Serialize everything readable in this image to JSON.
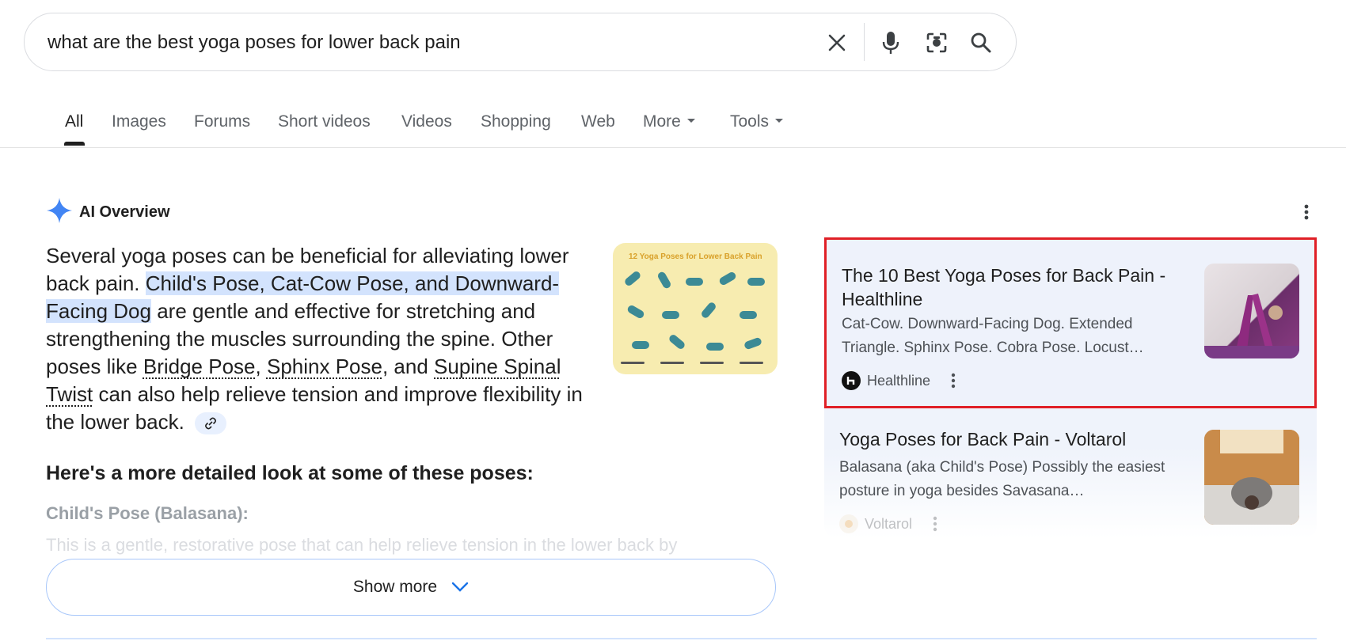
{
  "search": {
    "query": "what are the best yoga poses for lower back pain"
  },
  "tabs": [
    "All",
    "Images",
    "Forums",
    "Short videos",
    "Videos",
    "Shopping",
    "Web",
    "More",
    "Tools"
  ],
  "ai_overview": {
    "title": "AI Overview",
    "body": {
      "p1": "Several yoga poses can be beneficial for alleviating lower back pain.",
      "highlight": "Child's Pose, Cat-Cow Pose, and Downward-Facing Dog",
      "p2": "are gentle and effective for stretching and strengthening the muscles surrounding the spine. Other poses like",
      "link1": "Bridge Pose",
      "link2": "Sphinx Pose",
      "sep": ", and",
      "link3": "Supine Spinal Twist",
      "p3": "can also help relieve tension and improve flexibility in the lower back."
    },
    "image_caption": "12 Yoga Poses for Lower Back Pain",
    "detail_heading": "Here's a more detailed look at some of these poses:",
    "sub_heading": "Child's Pose (Balasana):",
    "faded_text": "This is a gentle, restorative pose that can help relieve tension in the lower back by",
    "show_more": "Show more"
  },
  "sources": [
    {
      "title": "The 10 Best Yoga Poses for Back Pain - Healthline",
      "snippet": "Cat-Cow. Downward-Facing Dog. Extended Triangle. Sphinx Pose. Cobra Pose. Locust…",
      "site": "Healthline"
    },
    {
      "title": "Yoga Poses for Back Pain - Voltarol",
      "snippet": "Balasana (aka Child's Pose) Possibly the easiest posture in yoga besides Savasana…",
      "site": "Voltarol"
    }
  ],
  "colors": {
    "highlight": "#d3e3fd",
    "annotation_box": "#e01f26",
    "gemini_blue": "#4285f4"
  }
}
